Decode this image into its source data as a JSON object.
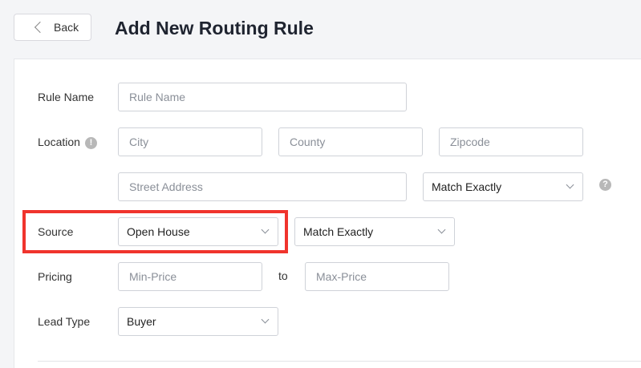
{
  "header": {
    "back_label": "Back",
    "title": "Add New Routing Rule"
  },
  "form": {
    "rule_name": {
      "label": "Rule Name",
      "placeholder": "Rule Name"
    },
    "location": {
      "label": "Location",
      "info_glyph": "!",
      "city_placeholder": "City",
      "county_placeholder": "County",
      "zipcode_placeholder": "Zipcode",
      "street_placeholder": "Street Address",
      "match_value": "Match Exactly",
      "help_glyph": "?"
    },
    "source": {
      "label": "Source",
      "value": "Open House",
      "match_value": "Match Exactly",
      "highlight_color": "#f0342d"
    },
    "pricing": {
      "label": "Pricing",
      "min_placeholder": "Min-Price",
      "to_text": "to",
      "max_placeholder": "Max-Price"
    },
    "lead_type": {
      "label": "Lead Type",
      "value": "Buyer"
    }
  }
}
